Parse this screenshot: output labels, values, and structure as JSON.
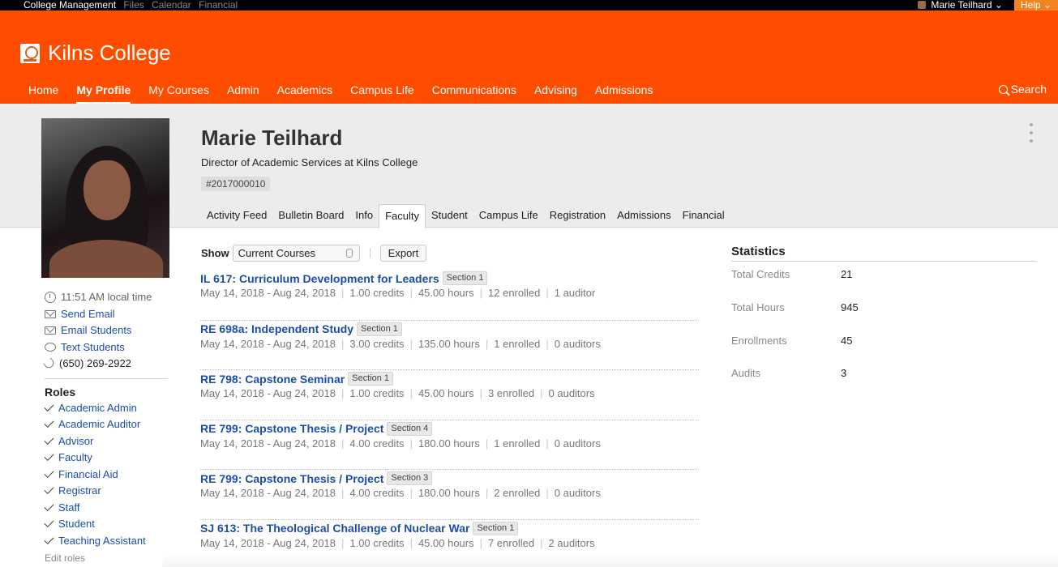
{
  "system_bar": {
    "app": "College Management",
    "items": [
      "Files",
      "Calendar",
      "Financial"
    ],
    "user": "Marie Teilhard",
    "help": "Help"
  },
  "header": {
    "brand": "Kilns College",
    "nav": [
      "Home",
      "My Profile",
      "My Courses",
      "Admin",
      "Academics",
      "Campus Life",
      "Communications",
      "Advising",
      "Admissions"
    ],
    "active_nav": "My Profile",
    "search": "Search",
    "accent": "#ff4d00"
  },
  "profile": {
    "name": "Marie Teilhard",
    "subtitle": "Director of Academic Services at Kilns College",
    "id": "#2017000010",
    "tabs": [
      "Activity Feed",
      "Bulletin Board",
      "Info",
      "Faculty",
      "Student",
      "Campus Life",
      "Registration",
      "Admissions",
      "Financial"
    ],
    "active_tab": "Faculty"
  },
  "contact": {
    "local_time": "11:51 AM local time",
    "send_email": "Send Email",
    "email_students": "Email Students",
    "text_students": "Text Students",
    "phone": "(650) 269-2922"
  },
  "roles": {
    "title": "Roles",
    "items": [
      "Academic Admin",
      "Academic Auditor",
      "Advisor",
      "Faculty",
      "Financial Aid",
      "Registrar",
      "Staff",
      "Student",
      "Teaching Assistant"
    ],
    "edit": "Edit roles"
  },
  "courses": {
    "show_label": "Show",
    "filter_value": "Current Courses",
    "export_label": "Export",
    "items": [
      {
        "title": "IL 617: Curriculum Development for Leaders",
        "section": "Section 1",
        "dates": "May 14, 2018 - Aug 24, 2018",
        "credits": "1.00 credits",
        "hours": "45.00 hours",
        "enrolled": "12 enrolled",
        "auditors": "1 auditor"
      },
      {
        "title": "RE 698a: Independent Study",
        "section": "Section 1",
        "dates": "May 14, 2018 - Aug 24, 2018",
        "credits": "3.00 credits",
        "hours": "135.00 hours",
        "enrolled": "1 enrolled",
        "auditors": "0 auditors"
      },
      {
        "title": "RE 798: Capstone Seminar",
        "section": "Section 1",
        "dates": "May 14, 2018 - Aug 24, 2018",
        "credits": "1.00 credits",
        "hours": "45.00 hours",
        "enrolled": "3 enrolled",
        "auditors": "0 auditors"
      },
      {
        "title": "RE 799: Capstone Thesis / Project",
        "section": "Section 4",
        "dates": "May 14, 2018 - Aug 24, 2018",
        "credits": "4.00 credits",
        "hours": "180.00 hours",
        "enrolled": "1 enrolled",
        "auditors": "0 auditors"
      },
      {
        "title": "RE 799: Capstone Thesis / Project",
        "section": "Section 3",
        "dates": "May 14, 2018 - Aug 24, 2018",
        "credits": "4.00 credits",
        "hours": "180.00 hours",
        "enrolled": "2 enrolled",
        "auditors": "0 auditors"
      },
      {
        "title": "SJ 613: The Theological Challenge of Nuclear War",
        "section": "Section 1",
        "dates": "May 14, 2018 - Aug 24, 2018",
        "credits": "1.00 credits",
        "hours": "45.00 hours",
        "enrolled": "7 enrolled",
        "auditors": "2 auditors"
      }
    ]
  },
  "statistics": {
    "title": "Statistics",
    "rows": [
      {
        "label": "Total Credits",
        "value": "21"
      },
      {
        "label": "Total Hours",
        "value": "945"
      },
      {
        "label": "Enrollments",
        "value": "45"
      },
      {
        "label": "Audits",
        "value": "3"
      }
    ]
  }
}
